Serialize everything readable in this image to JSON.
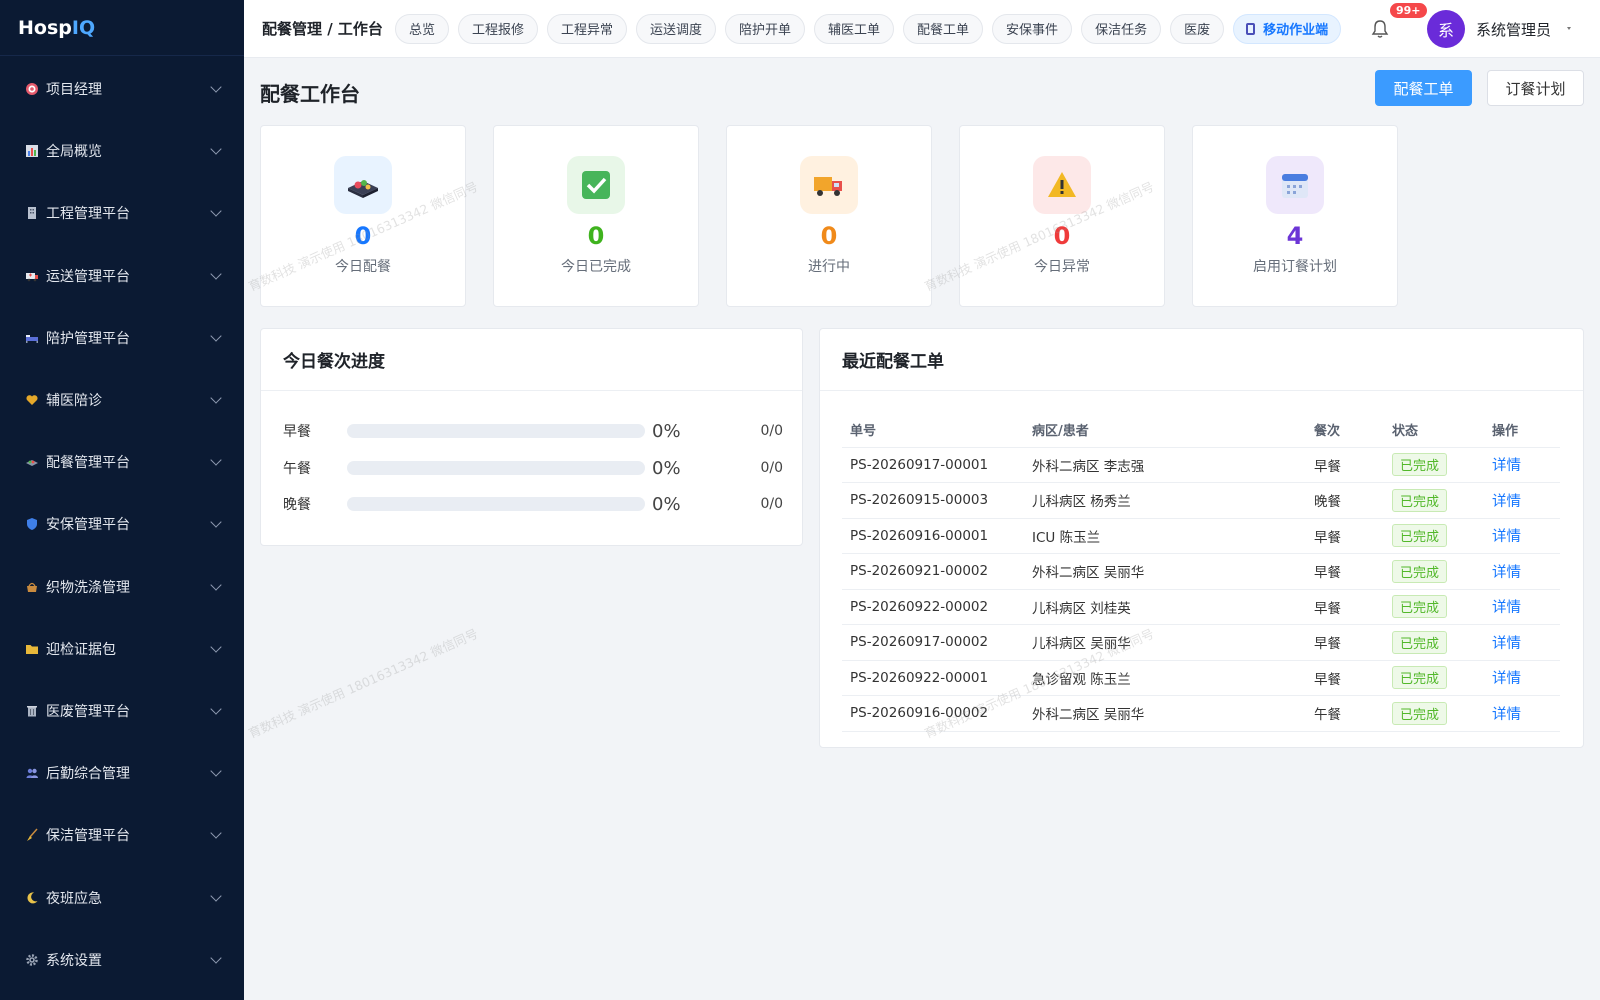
{
  "brand": {
    "part1": "Hosp",
    "part2": "IQ"
  },
  "sidebar": {
    "items": [
      {
        "label": "项目经理",
        "icon": "target-icon"
      },
      {
        "label": "全局概览",
        "icon": "bar-chart-icon"
      },
      {
        "label": "工程管理平台",
        "icon": "building-icon"
      },
      {
        "label": "运送管理平台",
        "icon": "ambulance-icon"
      },
      {
        "label": "陪护管理平台",
        "icon": "bed-icon"
      },
      {
        "label": "辅医陪诊",
        "icon": "heart-icon"
      },
      {
        "label": "配餐管理平台",
        "icon": "meal-icon"
      },
      {
        "label": "安保管理平台",
        "icon": "shield-icon"
      },
      {
        "label": "织物洗涤管理",
        "icon": "basket-icon"
      },
      {
        "label": "迎检证据包",
        "icon": "folder-icon"
      },
      {
        "label": "医废管理平台",
        "icon": "trash-icon"
      },
      {
        "label": "后勤综合管理",
        "icon": "people-icon"
      },
      {
        "label": "保洁管理平台",
        "icon": "broom-icon"
      },
      {
        "label": "夜班应急",
        "icon": "moon-icon"
      },
      {
        "label": "系统设置",
        "icon": "gear-icon"
      }
    ]
  },
  "header": {
    "breadcrumb": "配餐管理 / 工作台",
    "tabs": [
      "总览",
      "工程报修",
      "工程异常",
      "运送调度",
      "陪护开单",
      "辅医工单",
      "配餐工单",
      "安保事件",
      "保洁任务",
      "医废"
    ],
    "mobile_tab": "移动作业端",
    "badge": "99+",
    "avatar_char": "系",
    "user_name": "系统管理员"
  },
  "page": {
    "title": "配餐工作台",
    "primary_button": "配餐工单",
    "secondary_button": "订餐计划"
  },
  "stats": [
    {
      "value": "0",
      "label": "今日配餐",
      "color": "#1677ff",
      "icon": "meal-tray-icon",
      "bg": "#e8f3ff"
    },
    {
      "value": "0",
      "label": "今日已完成",
      "color": "#3fb31e",
      "icon": "check-box-icon",
      "bg": "#e8f7e8"
    },
    {
      "value": "0",
      "label": "进行中",
      "color": "#f08a1a",
      "icon": "truck-icon",
      "bg": "#fff1e0"
    },
    {
      "value": "0",
      "label": "今日异常",
      "color": "#ef3b3b",
      "icon": "warning-icon",
      "bg": "#fde8e8"
    },
    {
      "value": "4",
      "label": "启用订餐计划",
      "color": "#6c35d6",
      "icon": "calendar-icon",
      "bg": "#efe8fb"
    }
  ],
  "progress_panel": {
    "title": "今日餐次进度",
    "rows": [
      {
        "label": "早餐",
        "percent_text": "0%",
        "count": "0/0",
        "fill": 0
      },
      {
        "label": "午餐",
        "percent_text": "0%",
        "count": "0/0",
        "fill": 0
      },
      {
        "label": "晚餐",
        "percent_text": "0%",
        "count": "0/0",
        "fill": 0
      }
    ]
  },
  "orders_panel": {
    "title": "最近配餐工单",
    "columns": [
      "单号",
      "病区/患者",
      "餐次",
      "状态",
      "操作"
    ],
    "rows": [
      {
        "id": "PS-20260917-00001",
        "ward": "外科二病区 李志强",
        "meal": "早餐",
        "status": "已完成",
        "action": "详情"
      },
      {
        "id": "PS-20260915-00003",
        "ward": "儿科病区 杨秀兰",
        "meal": "晚餐",
        "status": "已完成",
        "action": "详情"
      },
      {
        "id": "PS-20260916-00001",
        "ward": "ICU 陈玉兰",
        "meal": "早餐",
        "status": "已完成",
        "action": "详情"
      },
      {
        "id": "PS-20260921-00002",
        "ward": "外科二病区 吴丽华",
        "meal": "早餐",
        "status": "已完成",
        "action": "详情"
      },
      {
        "id": "PS-20260922-00002",
        "ward": "儿科病区 刘桂英",
        "meal": "早餐",
        "status": "已完成",
        "action": "详情"
      },
      {
        "id": "PS-20260917-00002",
        "ward": "儿科病区 吴丽华",
        "meal": "早餐",
        "status": "已完成",
        "action": "详情"
      },
      {
        "id": "PS-20260922-00001",
        "ward": "急诊留观 陈玉兰",
        "meal": "早餐",
        "status": "已完成",
        "action": "详情"
      },
      {
        "id": "PS-20260916-00002",
        "ward": "外科二病区 吴丽华",
        "meal": "午餐",
        "status": "已完成",
        "action": "详情"
      }
    ]
  },
  "watermark": "育数科技 演示使用 18016313342 微信同号"
}
